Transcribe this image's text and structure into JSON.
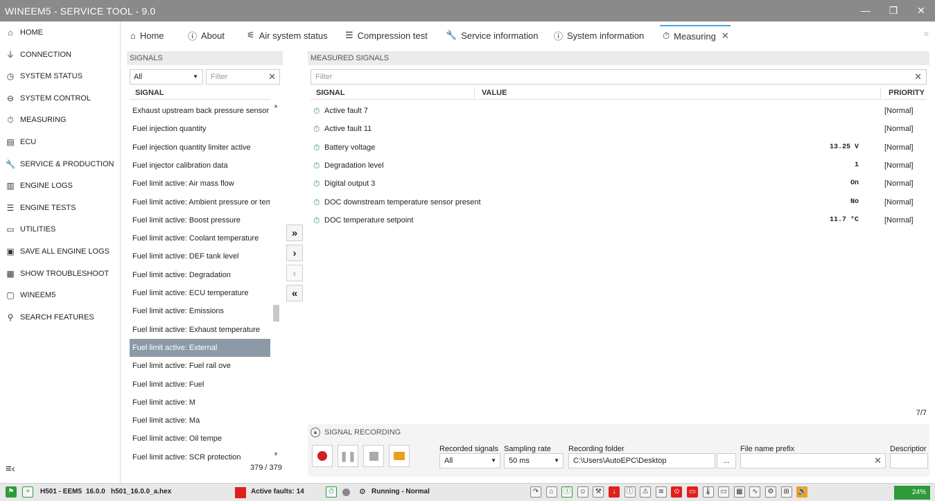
{
  "app": {
    "title": "WINEEM5 - SERVICE TOOL - 9.0"
  },
  "sidebar": {
    "items": [
      {
        "icon": "home-icon",
        "glyph": "⌂",
        "label": "HOME"
      },
      {
        "icon": "plug-icon",
        "glyph": "⏚",
        "label": "CONNECTION"
      },
      {
        "icon": "status-icon",
        "glyph": "◷",
        "label": "SYSTEM STATUS"
      },
      {
        "icon": "toggle-icon",
        "glyph": "⊖",
        "label": "SYSTEM CONTROL"
      },
      {
        "icon": "stopwatch-icon",
        "glyph": "⏱",
        "label": "MEASURING"
      },
      {
        "icon": "chip-icon",
        "glyph": "▤",
        "label": "ECU"
      },
      {
        "icon": "wrench-icon",
        "glyph": "🔧",
        "label": "SERVICE & PRODUCTION"
      },
      {
        "icon": "chart-icon",
        "glyph": "▥",
        "label": "ENGINE LOGS"
      },
      {
        "icon": "tests-icon",
        "glyph": "☰",
        "label": "ENGINE TESTS"
      },
      {
        "icon": "briefcase-icon",
        "glyph": "▭",
        "label": "UTILITIES"
      },
      {
        "icon": "save-icon",
        "glyph": "▣",
        "label": "SAVE ALL ENGINE LOGS"
      },
      {
        "icon": "book-icon",
        "glyph": "▦",
        "label": "SHOW TROUBLESHOOT"
      },
      {
        "icon": "window-icon",
        "glyph": "▢",
        "label": "WINEEM5"
      },
      {
        "icon": "search-icon",
        "glyph": "⚲",
        "label": "SEARCH FEATURES"
      }
    ]
  },
  "tabs": [
    {
      "icon": "home-icon",
      "glyph": "⌂",
      "label": "Home"
    },
    {
      "icon": "info-icon",
      "glyph": "ⓘ",
      "label": "About"
    },
    {
      "icon": "air-icon",
      "glyph": "⚟",
      "label": "Air system status"
    },
    {
      "icon": "compression-icon",
      "glyph": "☰",
      "label": "Compression test"
    },
    {
      "icon": "wrench-icon",
      "glyph": "🔧",
      "label": "Service information"
    },
    {
      "icon": "info-icon",
      "glyph": "ⓘ",
      "label": "System information"
    },
    {
      "icon": "stopwatch-icon",
      "glyph": "⏱",
      "label": "Measuring"
    }
  ],
  "signals_panel": {
    "title": "SIGNALS",
    "filter_select": "All",
    "filter_placeholder": "Filter",
    "column": "SIGNAL",
    "count": "379 / 379",
    "rows": [
      "Exhaust upstream back pressure sensor pr",
      "Fuel injection quantity",
      "Fuel injection quantity limiter active",
      "Fuel injector calibration data",
      "Fuel limit active: Air mass flow",
      "Fuel limit active: Ambient pressure or temp",
      "Fuel limit active: Boost pressure",
      "Fuel limit active: Coolant temperature",
      "Fuel limit active: DEF tank level",
      "Fuel limit active: Degradation",
      "Fuel limit active: ECU temperature",
      "Fuel limit active: Emissions",
      "Fuel limit active: Exhaust temperature",
      "Fuel limit active: External",
      "Fuel limit active: Fuel rail ove",
      "Fuel limit active: Fuel",
      "Fuel limit active: M",
      "Fuel limit active: Ma",
      "Fuel limit active: Oil tempe",
      "Fuel limit active: SCR protection"
    ]
  },
  "measured_panel": {
    "title": "MEASURED SIGNALS",
    "filter_placeholder": "Filter",
    "columns": {
      "signal": "SIGNAL",
      "value": "VALUE",
      "priority": "PRIORITY"
    },
    "count": "7/7",
    "rows": [
      {
        "name": "Active fault 7",
        "value": "",
        "priority": "[Normal]"
      },
      {
        "name": "Active fault 11",
        "value": "",
        "priority": "[Normal]"
      },
      {
        "name": "Battery voltage",
        "value": "13.25 V",
        "priority": "[Normal]"
      },
      {
        "name": "Degradation level",
        "value": "1",
        "priority": "[Normal]"
      },
      {
        "name": "Digital output 3",
        "value": "On",
        "priority": "[Normal]"
      },
      {
        "name": "DOC downstream temperature sensor present",
        "value": "No",
        "priority": "[Normal]"
      },
      {
        "name": "DOC temperature setpoint",
        "value": "11.7 °C",
        "priority": "[Normal]"
      }
    ]
  },
  "recording": {
    "title": "SIGNAL RECORDING",
    "recorded_signals_label": "Recorded signals",
    "recorded_signals_value": "All",
    "sampling_rate_label": "Sampling rate",
    "sampling_rate_value": "50 ms",
    "folder_label": "Recording folder",
    "folder_value": "C:\\Users\\AutoEPC\\Desktop",
    "browse": "...",
    "prefix_label": "File name prefix",
    "description_label": "Descriptior"
  },
  "status": {
    "device": "H501 - EEM5",
    "version": "16.0.0",
    "file": "h501_16.0.0_a.hex",
    "faults": "Active faults: 14",
    "engine": "Running - Normal",
    "battery": "24%",
    "colors": {
      "fault": "#e0201c",
      "ok": "#2e9a3a"
    }
  }
}
